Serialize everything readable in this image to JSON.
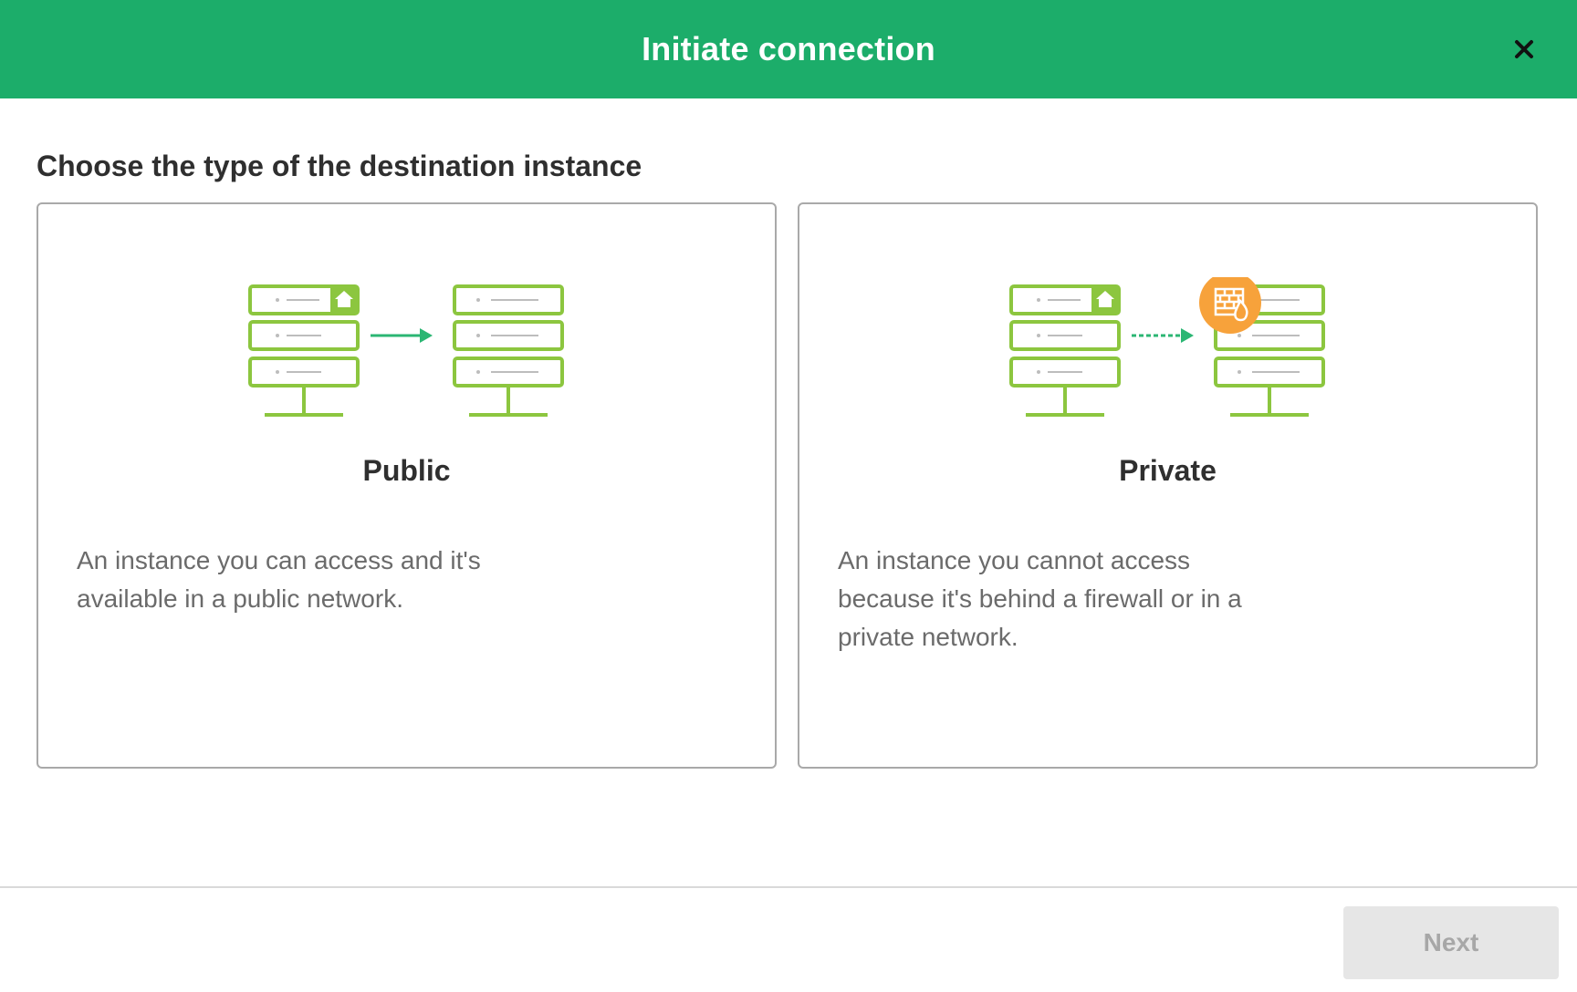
{
  "dialog": {
    "title": "Initiate connection"
  },
  "main": {
    "subtitle": "Choose the type of the destination instance",
    "options": [
      {
        "title": "Public",
        "description": "An instance you can access and it's available in a public network.",
        "icon": "server-to-server-direct-icon"
      },
      {
        "title": "Private",
        "description": "An instance you cannot access because it's behind a firewall or in a private network.",
        "icon": "server-to-firewall-server-icon"
      }
    ]
  },
  "footer": {
    "next_label": "Next"
  },
  "colors": {
    "header_bg": "#1cad6a",
    "server_green": "#8cc63f",
    "arrow_green": "#2bb673",
    "firewall_orange": "#f7a23b",
    "disabled_button_bg": "#e6e6e6",
    "disabled_button_text": "#a7a7a7"
  }
}
